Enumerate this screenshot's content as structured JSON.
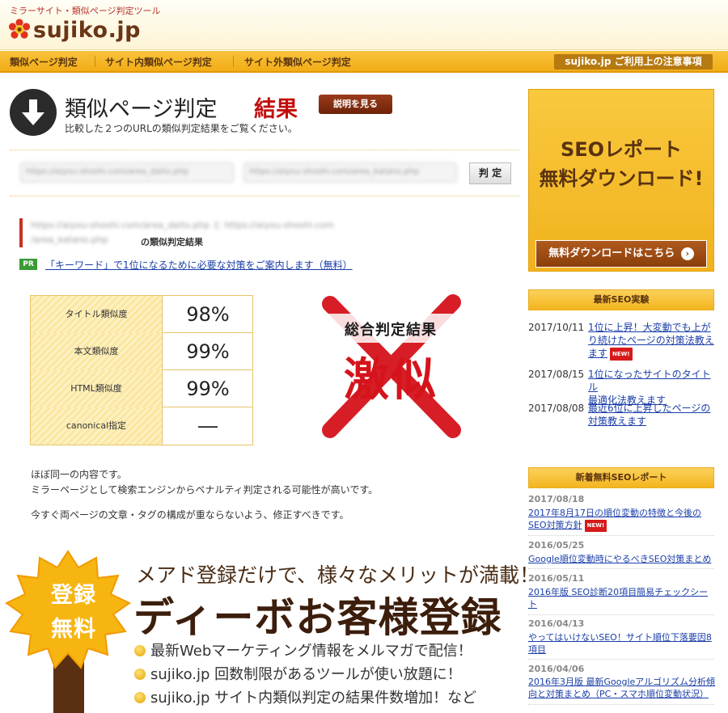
{
  "header": {
    "tagline": "ミラーサイト・類似ページ判定ツール",
    "logo_text": "sujiko.jp"
  },
  "nav": {
    "items": [
      "類似ページ判定",
      "サイト内類似ページ判定",
      "サイト外類似ページ判定"
    ],
    "notice": "sujiko.jp ご利用上の注意事項"
  },
  "page": {
    "title": "類似ページ判定",
    "title_accent": "結果",
    "explain_button": "説明を見る",
    "subtitle": "比較した２つのURLの類似判定結果をご覧ください。"
  },
  "form": {
    "url1": "https://aiyou-shoshi.com/area_daito.php",
    "url2": "https://aiyou-shoshi.com/area_katano.php",
    "submit_label": "判 定"
  },
  "result": {
    "urls_line1": "https://aiyou-shoshi.com/area_daito.php と https://aiyou-shoshi.com",
    "urls_line2": "/area_katano.php",
    "urls_suffix": "の類似判定結果",
    "pr_badge": "PR",
    "pr_link": "「キーワード」で1位になるために必要な対策をご案内します（無料）",
    "scores": [
      {
        "label": "タイトル類似度",
        "value": "98%"
      },
      {
        "label": "本文類似度",
        "value": "99%"
      },
      {
        "label": "HTML類似度",
        "value": "99%"
      },
      {
        "label": "canonical指定",
        "value": "―"
      }
    ],
    "verdict_title": "総合判定結果",
    "verdict_value": "激似",
    "verdict_text": [
      "ほぼ同一の内容です。",
      "ミラーページとして検索エンジンからペナルティ判定される可能性が高いです。",
      "今すぐ両ページの文章・タグの構成が重ならないよう、修正すべきです。"
    ]
  },
  "promo": {
    "burst_line1": "登録",
    "burst_line2": "無料",
    "tagline": "メアド登録だけで、様々なメリットが満載！",
    "headline": "ディーボお客様登録",
    "bullets": [
      "最新Webマーケティング情報をメルマガで配信！",
      "sujiko.jp 回数制限があるツールが使い放題に！",
      "sujiko.jp サイト内類似判定の結果件数増加！など"
    ]
  },
  "sidebar": {
    "banner_line1": "SEOレポート",
    "banner_line2": "無料ダウンロード!",
    "banner_button": "無料ダウンロードはこちら",
    "experiments_title": "最新SEO実験",
    "experiments": [
      {
        "date": "2017/10/11",
        "line1": "1位に上昇！大変動でも上が",
        "line2": "り続けたページの対策法教え",
        "line3": "ます",
        "new": "NEW!"
      },
      {
        "date": "2017/08/15",
        "line1": "1位になったサイトのタイトル",
        "line2": "最適化法教えます",
        "line3": "",
        "new": ""
      },
      {
        "date": "2017/08/08",
        "line1": "最近6位に上昇したページの",
        "line2": "対策教えます",
        "line3": "",
        "new": ""
      }
    ],
    "reports_title": "新着無料SEOレポート",
    "reports": [
      {
        "date": "2017/08/18",
        "line1": "2017年8月17日の順位変動の特徴と今後の",
        "line2": "SEO対策方針",
        "new": "NEW!"
      },
      {
        "date": "2016/05/25",
        "line1": "Google順位変動時にやるべきSEO対策まとめ",
        "line2": "",
        "new": ""
      },
      {
        "date": "2016/05/11",
        "line1": "2016年版 SEO診断20項目簡易チェックシー",
        "line2": "ト",
        "new": ""
      },
      {
        "date": "2016/04/13",
        "line1": "やってはいけないSEO！サイト順位下落要因8",
        "line2": "項目",
        "new": ""
      },
      {
        "date": "2016/04/06",
        "line1": "2016年3月版 最新Googleアルゴリズム分析傾",
        "line2": "向と対策まとめ（PC・スマホ順位変動状況）",
        "new": ""
      }
    ]
  },
  "colors": {
    "accent_red": "#c40c0c",
    "nav_gold": "#f2ad16",
    "link_blue": "#1a3ea8",
    "brown": "#5a3210"
  }
}
